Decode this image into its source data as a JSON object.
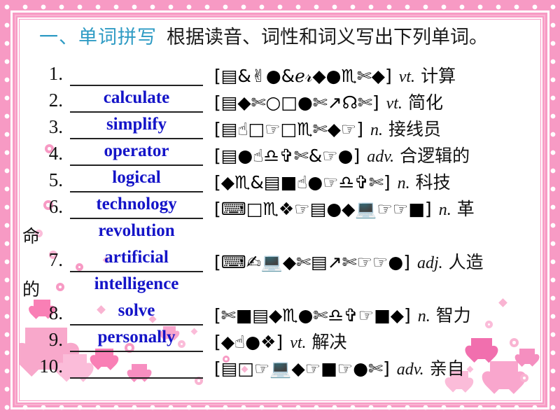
{
  "slide": {
    "title_label": "一、单词拼写",
    "title_instruction": "根据读音、词性和词义写出下列单词。",
    "title_color": "#2e9bc4",
    "answer_color": "#1414c8",
    "border_color": "#f79ac4",
    "dot_color": "#ffffff"
  },
  "items": [
    {
      "number": "1.",
      "answer": "",
      "phonetic": "▤&✌●&ℯ𝓇◆●♏✄◆",
      "pos": "vt.",
      "meaning": "计算",
      "overflow_cn": "",
      "overflow_answer": ""
    },
    {
      "number": "2.",
      "answer": "calculate",
      "phonetic": "▤◆✄○□●✄↗☊✄",
      "pos": "vt.",
      "meaning": "简化",
      "overflow_cn": "",
      "overflow_answer": ""
    },
    {
      "number": "3.",
      "answer": "simplify",
      "phonetic": "▤☝□☞□♏✄◆☞",
      "pos": "n.",
      "meaning": "接线员",
      "overflow_cn": "",
      "overflow_answer": ""
    },
    {
      "number": "4.",
      "answer": "operator",
      "phonetic": "▤●☝♎✞✄&☞●",
      "pos": "adv.",
      "meaning": "合逻辑的",
      "overflow_cn": "",
      "overflow_answer": ""
    },
    {
      "number": "5.",
      "answer": "logical",
      "phonetic": "◆♏&▤■☝●☞♎✞✄",
      "pos": "n.",
      "meaning": "科技",
      "overflow_cn": "",
      "overflow_answer": ""
    },
    {
      "number": "6.",
      "answer": "technology",
      "phonetic": "⌨□♏❖☞▤●◆💻☞☞■",
      "pos": "n.",
      "meaning": "革",
      "overflow_cn": "命",
      "overflow_answer": "revolution"
    },
    {
      "number": "7.",
      "answer": "artificial",
      "phonetic": "⌨✍💻◆✄▤↗✄☞☞●",
      "pos": "adj.",
      "meaning": "人造",
      "overflow_cn": "的",
      "overflow_answer": "intelligence"
    },
    {
      "number": "8.",
      "answer": "solve",
      "phonetic": "✄■▤◆♏●✄♎✞☞■◆",
      "pos": "n.",
      "meaning": "智力",
      "overflow_cn": "",
      "overflow_answer": ""
    },
    {
      "number": "9.",
      "answer": "personally",
      "phonetic": "◆☝●❖",
      "pos": "vt.",
      "meaning": "解决",
      "overflow_cn": "",
      "overflow_answer": ""
    },
    {
      "number": "10.",
      "answer": "",
      "phonetic": "▤□☞💻◆☞■☞●✄",
      "pos": "adv.",
      "meaning": "亲自",
      "overflow_cn": "",
      "overflow_answer": ""
    }
  ]
}
